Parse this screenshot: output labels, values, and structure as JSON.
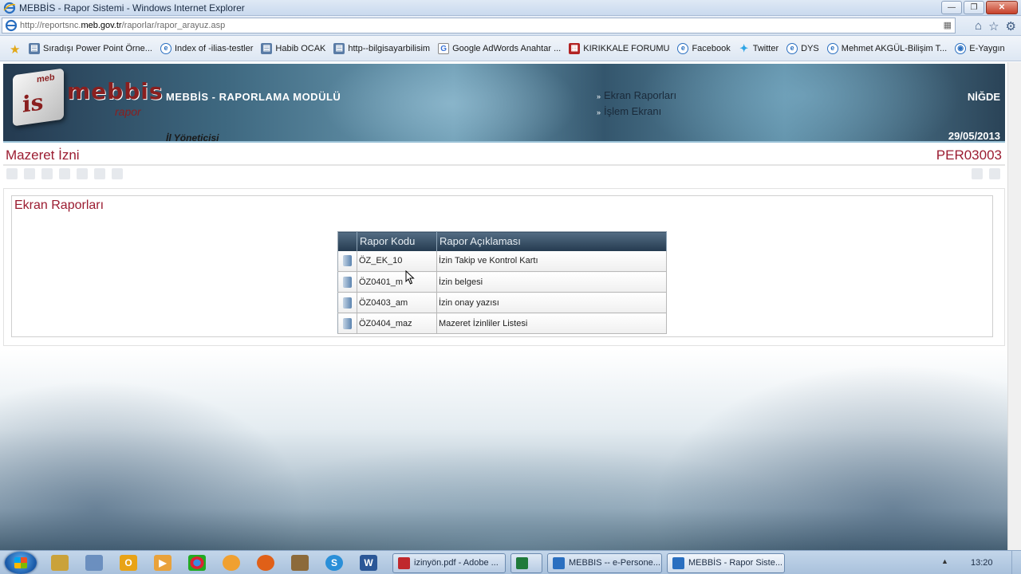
{
  "window": {
    "title": "MEBBİS - Rapor Sistemi - Windows Internet Explorer",
    "url_prefix": "http://reportsnc.",
    "url_domain": "meb.gov.tr",
    "url_path": "/raporlar/rapor_arayuz.asp"
  },
  "favorites": [
    {
      "label": "Sıradışı Power Point Örne...",
      "icon": "doc-icon"
    },
    {
      "label": "Index of -ilias-testler",
      "icon": "ie-icon"
    },
    {
      "label": "Habib OCAK",
      "icon": "doc-icon"
    },
    {
      "label": "http--bilgisayarbilisim",
      "icon": "doc-icon"
    },
    {
      "label": "Google AdWords Anahtar ...",
      "icon": "google-icon"
    },
    {
      "label": "KIRIKKALE FORUMU",
      "icon": "forum-icon"
    },
    {
      "label": "Facebook",
      "icon": "ie-icon"
    },
    {
      "label": "Twitter",
      "icon": "twitter-icon"
    },
    {
      "label": "DYS",
      "icon": "ie-icon"
    },
    {
      "label": "Mehmet AKGÜL-Bilişim T...",
      "icon": "ie-icon"
    },
    {
      "label": "E-Yaygın",
      "icon": "globe-icon"
    }
  ],
  "banner": {
    "logo_meb": "meb",
    "logo_is": "is",
    "logo_text": "mebbis",
    "logo_sub": "rapor",
    "module_title": "MEBBİS - RAPORLAMA MODÜLÜ",
    "user_role": "İl Yöneticisi",
    "menu": [
      "Ekran Raporları",
      "İşlem Ekranı"
    ],
    "city": "NİĞDE",
    "date": "29/05/2013"
  },
  "page": {
    "title": "Mazeret İzni",
    "code": "PER03003",
    "panel_title": "Ekran Raporları"
  },
  "report_table": {
    "headers": [
      "Rapor Kodu",
      "Rapor Açıklaması"
    ],
    "rows": [
      {
        "code": "ÖZ_EK_10",
        "desc": "İzin Takip ve Kontrol Kartı"
      },
      {
        "code": "ÖZ0401_m",
        "desc": "İzin belgesi"
      },
      {
        "code": "ÖZ0403_am",
        "desc": "İzin onay yazısı"
      },
      {
        "code": "ÖZ0404_maz",
        "desc": "Mazeret İzinliler Listesi"
      }
    ]
  },
  "taskbar": {
    "tasks": [
      {
        "label": "izinyön.pdf - Adobe ...",
        "color": "#c0282d"
      },
      {
        "label": "",
        "color": "#1f7a3a"
      },
      {
        "label": "MEBBIS -- e-Persone...",
        "color": "#2a6fc0"
      },
      {
        "label": "MEBBİS - Rapor Siste...",
        "color": "#2a6fc0"
      }
    ],
    "clock": "13:20"
  },
  "colors": {
    "accent_red": "#9b1c31",
    "table_header": "#243a4f"
  }
}
